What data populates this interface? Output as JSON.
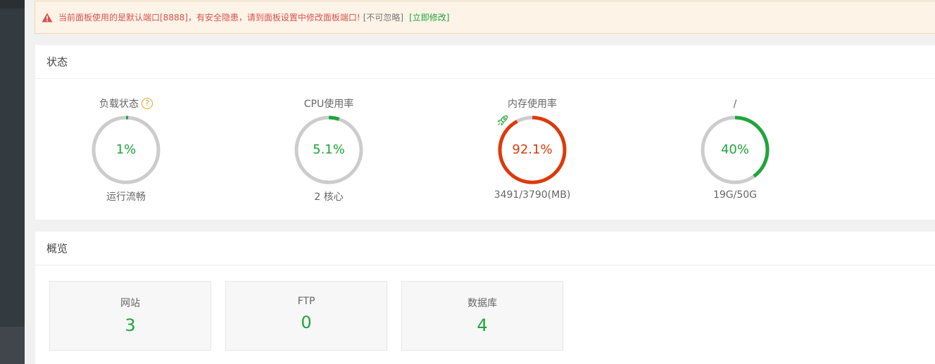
{
  "alert": {
    "message": "当前面板使用的是默认端口[8888]，有安全隐患，请到面板设置中修改面板端口!",
    "ignore_label": "[不可忽略]",
    "fix_label": "[立即修改]"
  },
  "status": {
    "title": "状态",
    "gauges": [
      {
        "label": "负载状态",
        "value_text": "1%",
        "percent": 1,
        "subtext": "运行流畅",
        "ring_color": "#20a53a",
        "text_color": "#20a53a"
      },
      {
        "label": "CPU使用率",
        "value_text": "5.1%",
        "percent": 5.1,
        "subtext": "2 核心",
        "ring_color": "#20a53a",
        "text_color": "#20a53a"
      },
      {
        "label": "内存使用率",
        "value_text": "92.1%",
        "percent": 92.1,
        "subtext": "3491/3790(MB)",
        "ring_color": "#dd3a0a",
        "text_color": "#dd3a0a"
      },
      {
        "label": "/",
        "value_text": "40%",
        "percent": 40,
        "subtext": "19G/50G",
        "ring_color": "#20a53a",
        "text_color": "#20a53a"
      }
    ]
  },
  "overview": {
    "title": "概览",
    "cards": [
      {
        "label": "网站",
        "value": "3"
      },
      {
        "label": "FTP",
        "value": "0"
      },
      {
        "label": "数据库",
        "value": "4"
      }
    ]
  },
  "icons": {
    "alert": "warning-triangle-icon",
    "help": "question-circle-icon",
    "memory_release": "rocket-icon"
  },
  "colors": {
    "ok": "#20a53a",
    "danger": "#dd3a0a",
    "track": "#cccccc",
    "warning_text": "#d9534f"
  }
}
